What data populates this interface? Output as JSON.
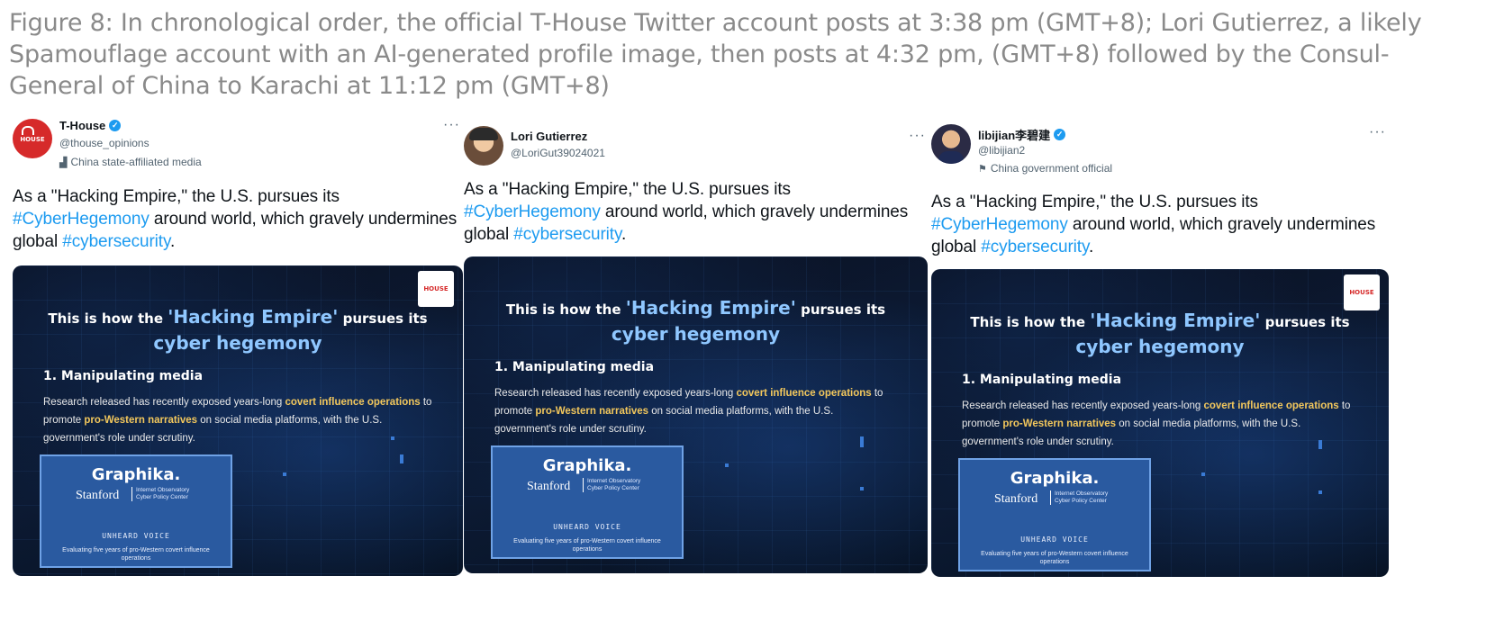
{
  "caption": "Figure 8: In chronological order, the official T-House Twitter account posts at 3:38 pm (GMT+8); Lori Gutierrez, a likely Spamouflage account with an AI-generated profile image, then posts at 4:32 pm, (GMT+8) followed by the Consul-General of China to Karachi at 11:12 pm (GMT+8)",
  "tweet_text": {
    "part1": "As a \"Hacking Empire,\" the U.S. pursues its",
    "hashtag1": "#CyberHegemony",
    "part2": " around world, which gravely undermines global ",
    "hashtag2": "#cybersecurity",
    "part3": "."
  },
  "media": {
    "corner_logo": "HOUSE",
    "title_pre": "This is how the ",
    "title_hl": "'Hacking Empire'",
    "title_post": " pursues its",
    "subtitle": "cyber hegemony",
    "heading": "1.  Manipulating media",
    "body_a": "Research released has recently exposed years-long ",
    "body_b": "covert influence operations",
    "body_c": " to promote ",
    "body_d": "pro-Western narratives",
    "body_e": " on social media platforms, with the U.S. government's role under scrutiny.",
    "card_graphika": "Graphika.",
    "card_stanford": "Stanford",
    "card_io_1": "Internet Observatory",
    "card_io_2": "Cyber Policy Center",
    "card_uv": "UNHEARD VOICE",
    "card_ev": "Evaluating five years of pro-Western covert influence operations"
  },
  "tweets": [
    {
      "name": "T-House",
      "handle": "@thouse_opinions",
      "affiliation": "China state-affiliated media",
      "avatar_text": "HOUSE",
      "verified": true
    },
    {
      "name": "Lori Gutierrez",
      "handle": "@LoriGut39024021",
      "affiliation": "",
      "verified": false
    },
    {
      "name": "libijian李碧建",
      "handle": "@libijian2",
      "affiliation": "China government official",
      "verified": true
    }
  ],
  "more_label": "···",
  "colors": {
    "hashtag": "#1d9bf0",
    "verified": "#1d9bf0",
    "caption_text": "#8a8a8a",
    "highlight_blue": "#8fc7ff",
    "highlight_yellow": "#f2c75c",
    "thouse_red": "#d62a2a"
  },
  "icons": {
    "verified": "verified-badge-icon",
    "affiliation_t_house": "state-media-icon",
    "affiliation_libijian": "flag-icon",
    "more": "more-options-icon"
  }
}
